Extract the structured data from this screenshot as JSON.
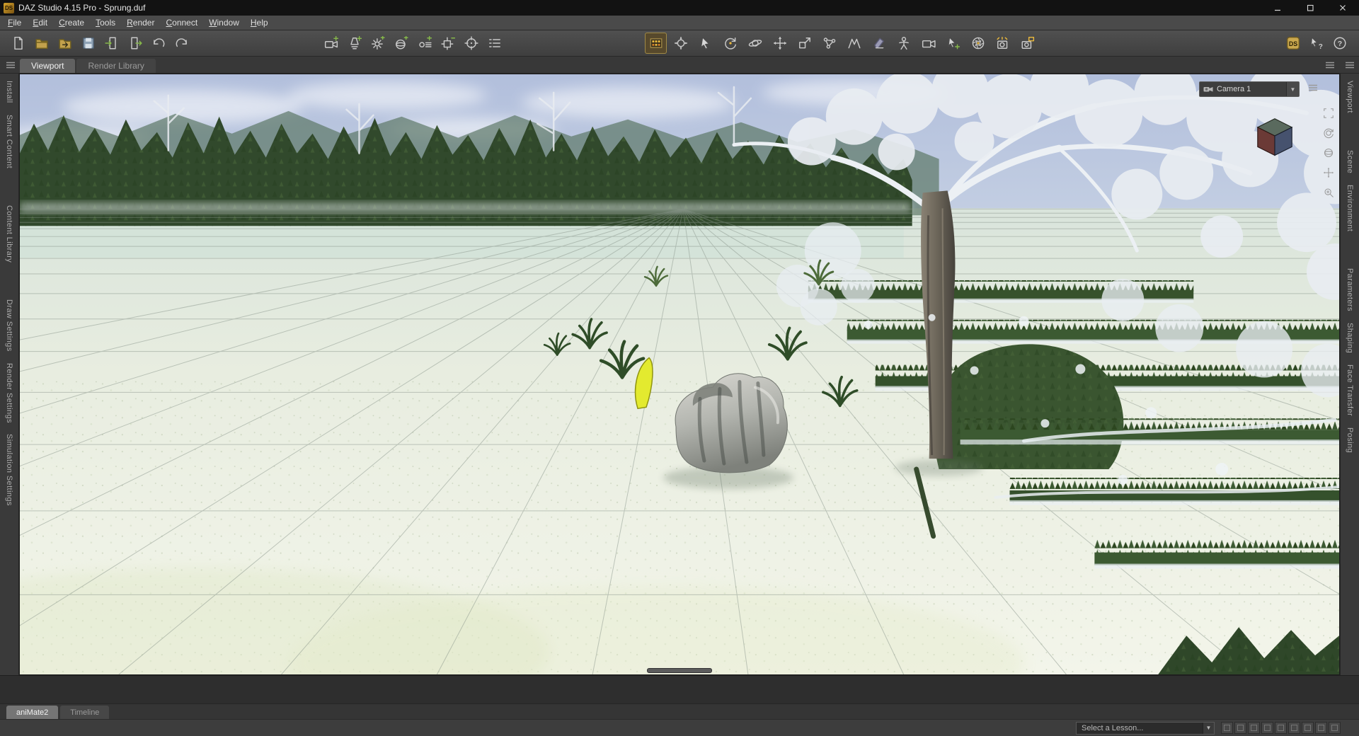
{
  "branding": {
    "app_logo_text": "DS"
  },
  "window": {
    "title": "DAZ Studio 4.15 Pro - Sprung.duf",
    "controls": [
      {
        "icon": "minimize-icon"
      },
      {
        "icon": "maximize-icon"
      },
      {
        "icon": "close-icon"
      }
    ]
  },
  "menu": {
    "items": [
      "File",
      "Edit",
      "Create",
      "Tools",
      "Render",
      "Connect",
      "Window",
      "Help"
    ]
  },
  "toolbar": {
    "groups": [
      {
        "name": "file",
        "items": [
          {
            "icon": "new-file"
          },
          {
            "icon": "open-file"
          },
          {
            "icon": "merge-file"
          },
          {
            "icon": "save-file"
          },
          {
            "icon": "import-file"
          },
          {
            "icon": "export-file"
          },
          {
            "icon": "undo"
          },
          {
            "icon": "redo"
          }
        ]
      },
      {
        "name": "create",
        "items": [
          {
            "icon": "add-camera"
          },
          {
            "icon": "add-spotlight"
          },
          {
            "icon": "add-point-light"
          },
          {
            "icon": "add-primitive"
          },
          {
            "icon": "add-distant-light"
          },
          {
            "icon": "add-null"
          },
          {
            "icon": "aim-frame"
          },
          {
            "icon": "list-options"
          }
        ]
      },
      {
        "name": "tools",
        "items": [
          {
            "icon": "scene-navigator",
            "active": true
          },
          {
            "icon": "universal-tool"
          },
          {
            "icon": "node-selection-tool"
          },
          {
            "icon": "rotate-tool"
          },
          {
            "icon": "orbit-tool"
          },
          {
            "icon": "translate-tool"
          },
          {
            "icon": "scale-tool"
          },
          {
            "icon": "node-editor-tool"
          },
          {
            "icon": "measure-tool"
          },
          {
            "icon": "surface-tool"
          },
          {
            "icon": "figure-tool"
          },
          {
            "icon": "camera-tool"
          },
          {
            "icon": "pointer-plus-tool"
          },
          {
            "icon": "lens-tool"
          },
          {
            "icon": "render-tool"
          },
          {
            "icon": "spot-render-tool"
          }
        ]
      },
      {
        "name": "help",
        "items": [
          {
            "icon": "daz-central"
          },
          {
            "icon": "whats-this"
          },
          {
            "icon": "help"
          }
        ]
      }
    ]
  },
  "viewport": {
    "tabs": [
      {
        "label": "Viewport",
        "active": true
      },
      {
        "label": "Render Library",
        "active": false
      }
    ],
    "camera_selector": {
      "value": "Camera 1"
    },
    "view_tools": [
      {
        "icon": "vt-frame"
      },
      {
        "icon": "vt-orbit"
      },
      {
        "icon": "vt-rotate"
      },
      {
        "icon": "vt-pan"
      },
      {
        "icon": "vt-dolly"
      }
    ]
  },
  "left_panel": {
    "groups": [
      {
        "tabs": [
          "Install",
          "Smart Content"
        ]
      },
      {
        "tabs": [
          "Content Library"
        ]
      },
      {
        "tabs": [
          "Draw Settings",
          "Render Settings",
          "Simulation Settings"
        ]
      }
    ]
  },
  "right_panel": {
    "groups": [
      {
        "tabs": [
          "Viewport"
        ]
      },
      {
        "tabs": [
          "Scene",
          "Environment"
        ]
      },
      {
        "tabs": [
          "Parameters",
          "Shaping",
          "Face Transfer",
          "Posing"
        ]
      }
    ]
  },
  "bottom": {
    "tabs": [
      {
        "label": "aniMate2",
        "active": true
      },
      {
        "label": "Timeline",
        "active": false
      }
    ],
    "lesson_selector": {
      "label": "Select a Lesson..."
    },
    "mini_button_count": 9
  },
  "colors": {
    "accent_yellow": "#e9b83d",
    "selection_marker": "#e3ea2f",
    "chrome": "#454545",
    "titlebar": "#121212"
  }
}
